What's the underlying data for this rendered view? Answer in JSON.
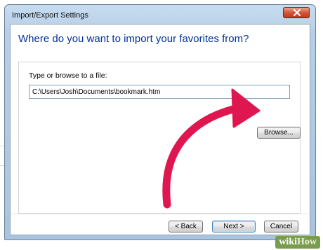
{
  "window": {
    "title": "Import/Export Settings"
  },
  "dialog": {
    "heading": "Where do you want to import your favorites from?",
    "field_label": "Type or browse to a file:",
    "file_path": "C:\\Users\\Josh\\Documents\\bookmark.htm",
    "browse_label": "Browse..."
  },
  "footer": {
    "back_label": "< Back",
    "next_label": "Next >",
    "cancel_label": "Cancel"
  },
  "overlay": {
    "arrow_color": "#e01650",
    "watermark_part1": "wiki",
    "watermark_part2": "How"
  },
  "colors": {
    "heading": "#003399",
    "close_button": "#d4573a",
    "titlebar": "#b6cfe8"
  }
}
